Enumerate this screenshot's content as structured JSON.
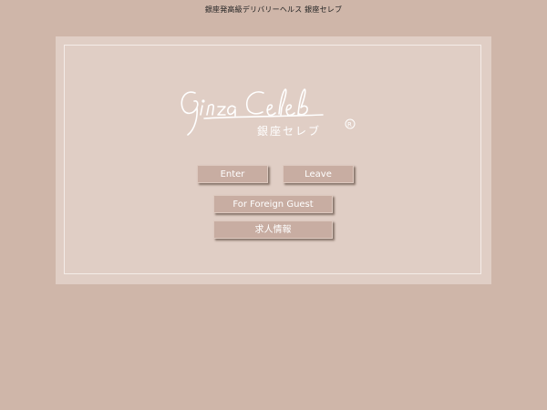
{
  "header": {
    "caption": "銀座発高級デリバリーヘルス 銀座セレブ"
  },
  "logo": {
    "script_text": "GinzaCeleb",
    "japanese_text": "銀座セレブ",
    "registered_mark": "®",
    "color": "#ffffff"
  },
  "buttons": {
    "enter": "Enter",
    "leave": "Leave",
    "foreign": "For Foreign Guest",
    "recruit": "求人情報"
  },
  "colors": {
    "background": "#cfb6a9",
    "panel": "#e0cec5",
    "button": "#c8ada2",
    "text": "#222222"
  }
}
